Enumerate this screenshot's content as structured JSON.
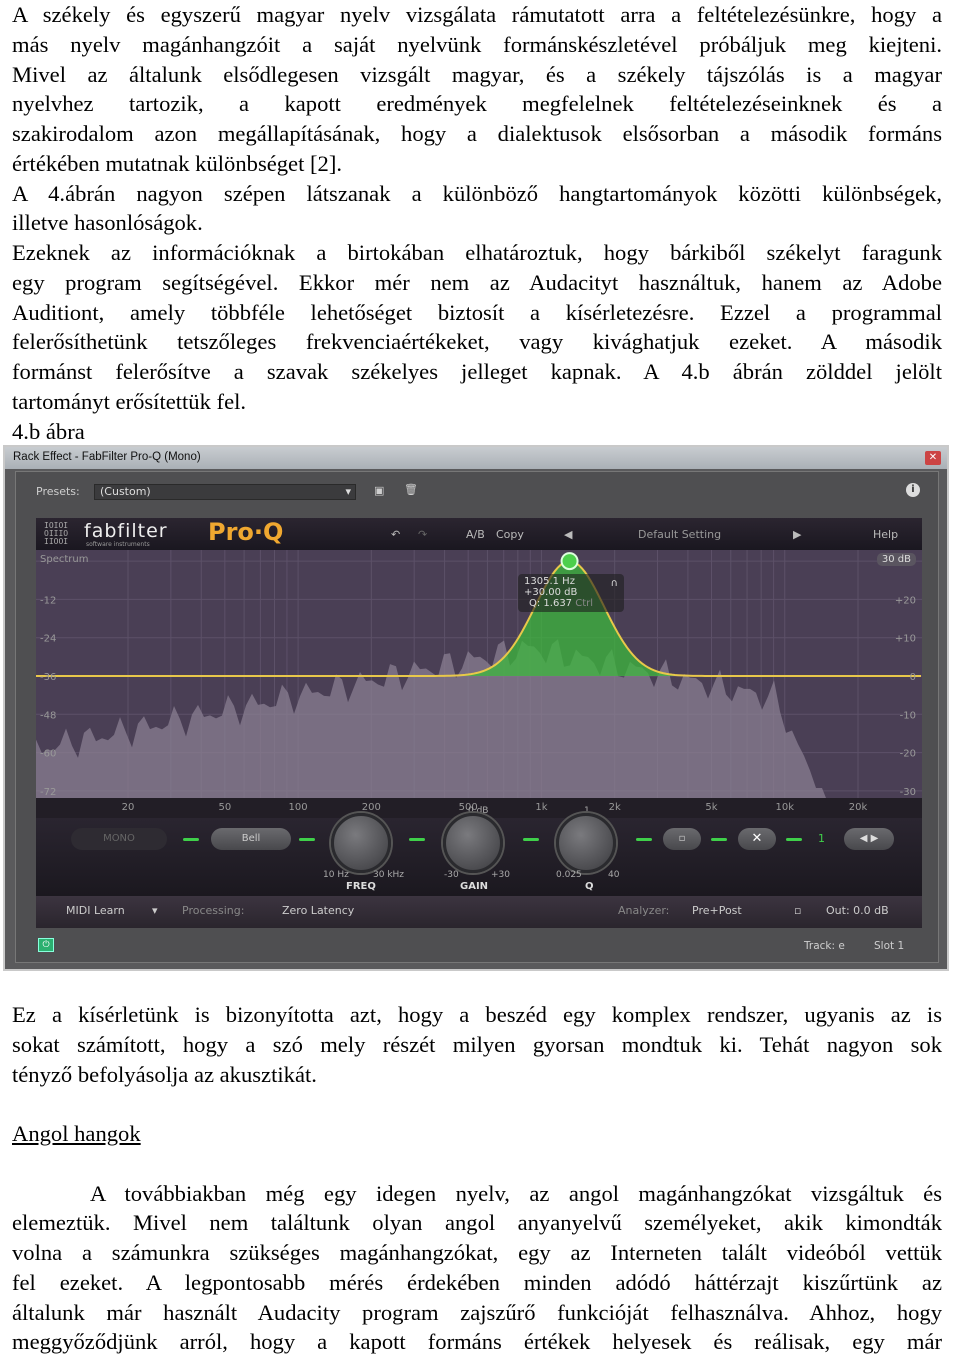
{
  "paragraph1": [
    "A székely és egyszerű magyar nyelv vizsgálata rámutatott arra a feltételezésünkre, hogy a",
    "más nyelv magánhangzóit a saját nyelvünk formánskészletével próbáljuk meg kiejteni.",
    "Mivel az általunk elsődlegesen vizsgált magyar, és a székely tájszólás is a magyar",
    "nyelvhez tartozik, a kapott eredmények megfelelnek feltételezéseinknek és a",
    "szakirodalom azon megállapításának, hogy a dialektusok elsősorban a második formáns",
    "értékében mutatnak különbséget [2]."
  ],
  "paragraph2": [
    "A 4.ábrán nagyon szépen látszanak a különböző hangtartományok közötti különbségek,",
    "illetve hasonlóságok."
  ],
  "paragraph3": [
    "Ezeknek az információknak a birtokában elhatároztuk, hogy bárkiből székelyt faragunk",
    "egy program segítségével. Ekkor mér nem az Audacityt használtuk, hanem az Adobe",
    "Auditiont, amely többféle lehetőséget biztosít a kísérletezésre. Ezzel a programmal",
    "felerősíthetünk tetszőleges frekvenciaértékeket, vagy kivághatjuk ezeket. A második",
    "formánst felerősítve a szavak székelyes jelleget kapnak. A 4.b ábrán zölddel jelölt",
    "tartományt erősítettük fel."
  ],
  "figure_caption": "4.b ábra",
  "paragraph4": [
    "Ez a kísérletünk is bizonyította azt, hogy a beszéd egy komplex rendszer, ugyanis az is",
    "sokat számított,  hogy a szó mely részét milyen gyorsan mondtuk ki. Tehát nagyon sok",
    "tényző befolyásolja az akusztikát."
  ],
  "heading": "Angol hangok",
  "paragraph5": [
    "A továbbiakban még egy idegen nyelv, az angol magánhangzókat vizsgáltuk és",
    "elemeztük. Mivel nem találtunk olyan angol anyanyelvű személyeket, akik kimondták",
    "volna a számunkra szükséges magánhangzókat, egy az Interneten talált videóból vettük",
    "fel ezeket. A legpontosabb mérés érdekében minden adódó háttérzajt kiszűrtünk az",
    "általunk már használt Audacity program zajszűrő funkcióját felhasználva. Ahhoz, hogy",
    "meggyőződjünk arról, hogy a kapott formáns értékek helyesek és reálisak, egy már"
  ],
  "screenshot": {
    "window_title": "Rack Effect - FabFilter Pro-Q (Mono)",
    "presets_label": "Presets:",
    "preset_value": "(Custom)",
    "brand": "fabfilter",
    "brand_sub": "software instruments",
    "product": "Pro·Q",
    "ab": "A/B",
    "copy": "Copy",
    "preset_name": "Default Setting",
    "help": "Help",
    "spectrum_label": "Spectrum",
    "range_button": "30 dB",
    "left_scale": [
      "-12",
      "-24",
      "-36",
      "-48",
      "-60",
      "-72"
    ],
    "right_scale": [
      "+20",
      "+10",
      "0",
      "-10",
      "-20",
      "-30"
    ],
    "freq_labels": [
      "20",
      "50",
      "100",
      "200",
      "500",
      "1k",
      "2k",
      "5k",
      "10k",
      "20k"
    ],
    "band_tooltip": {
      "freq": "1305.1 Hz",
      "gain": "+30.00 dB",
      "q": "Q: 1.637",
      "ctrl": "Ctrl"
    },
    "band": {
      "freq_hz": 1305.1,
      "gain_db": 30,
      "q": 1.637
    },
    "mono": "MONO",
    "shape": "Bell",
    "freq_knob": {
      "min": "10 Hz",
      "max": "30 kHz",
      "label": "FREQ"
    },
    "gain_knob": {
      "center": "0 dB",
      "min": "-30",
      "max": "+30",
      "label": "GAIN"
    },
    "q_knob": {
      "center": "1",
      "min": "0.025",
      "max": "40",
      "label": "Q"
    },
    "band_number": "1",
    "midi_learn": "MIDI Learn",
    "processing_label": "Processing:",
    "processing_value": "Zero Latency",
    "analyzer_label": "Analyzer:",
    "analyzer_value": "Pre+Post",
    "out": "Out: 0.0 dB",
    "track": "Track: e",
    "slot": "Slot 1",
    "colors": {
      "eq_curve": "#e8c84a",
      "band_fill": "#3cb83c",
      "graph_bg": "#4a3f55",
      "accent_green": "#3fd04a"
    }
  }
}
